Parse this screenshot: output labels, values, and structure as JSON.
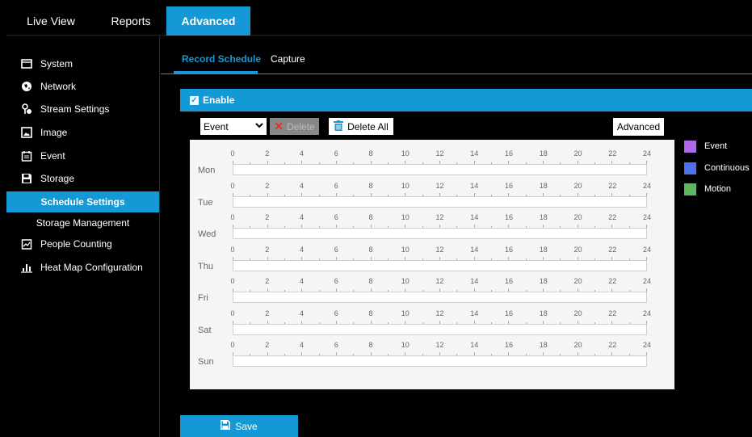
{
  "topnav": {
    "tabs": [
      {
        "label": "Live View"
      },
      {
        "label": "Reports"
      },
      {
        "label": "Advanced"
      }
    ]
  },
  "sidebar": {
    "items": [
      {
        "label": "System",
        "icon": "monitor-icon"
      },
      {
        "label": "Network",
        "icon": "globe-icon"
      },
      {
        "label": "Stream Settings",
        "icon": "stream-icon"
      },
      {
        "label": "Image",
        "icon": "image-icon"
      },
      {
        "label": "Event",
        "icon": "calendar-icon"
      },
      {
        "label": "Storage",
        "icon": "storage-icon"
      },
      {
        "label": "Schedule Settings",
        "icon": ""
      },
      {
        "label": "Storage Management",
        "icon": ""
      },
      {
        "label": "People Counting",
        "icon": "people-counting-icon"
      },
      {
        "label": "Heat Map Configuration",
        "icon": "bar-chart-icon"
      }
    ]
  },
  "subtabs": [
    {
      "label": "Record Schedule"
    },
    {
      "label": "Capture"
    }
  ],
  "enable": {
    "label": "Enable",
    "checked": true
  },
  "toolbar": {
    "type_value": "Event",
    "delete_label": "Delete",
    "delete_all_label": "Delete All",
    "advanced_label": "Advanced"
  },
  "schedule": {
    "hour_labels": [
      "0",
      "2",
      "4",
      "6",
      "8",
      "10",
      "12",
      "14",
      "16",
      "18",
      "20",
      "22",
      "24"
    ],
    "days": [
      {
        "label": "Mon"
      },
      {
        "label": "Tue"
      },
      {
        "label": "Wed"
      },
      {
        "label": "Thu"
      },
      {
        "label": "Fri"
      },
      {
        "label": "Sat"
      },
      {
        "label": "Sun"
      }
    ]
  },
  "legend": [
    {
      "label": "Event",
      "color": "#b067ef"
    },
    {
      "label": "Continuous",
      "color": "#4f6ef2"
    },
    {
      "label": "Motion",
      "color": "#5cb85c"
    }
  ],
  "save_label": "Save",
  "colors": {
    "accent": "#1598d6"
  }
}
